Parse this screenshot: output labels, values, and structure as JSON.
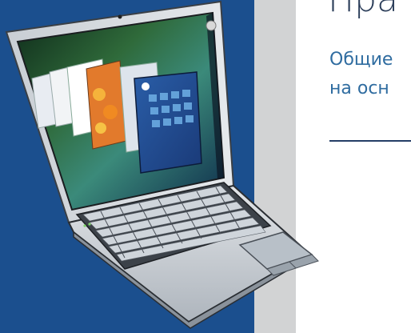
{
  "slide": {
    "title": "Пра",
    "subtitle_line1": "Общие",
    "subtitle_line2": "на осн"
  },
  "colors": {
    "blue_panel": "#1b4f8e",
    "gray_panel": "#d2d3d4",
    "title": "#2c3e5a",
    "subtitle": "#2f6ca0",
    "rule": "#243d66"
  },
  "illustration": {
    "subject": "laptop-illustration",
    "screen_content": "desktop-flip3d-windows"
  }
}
